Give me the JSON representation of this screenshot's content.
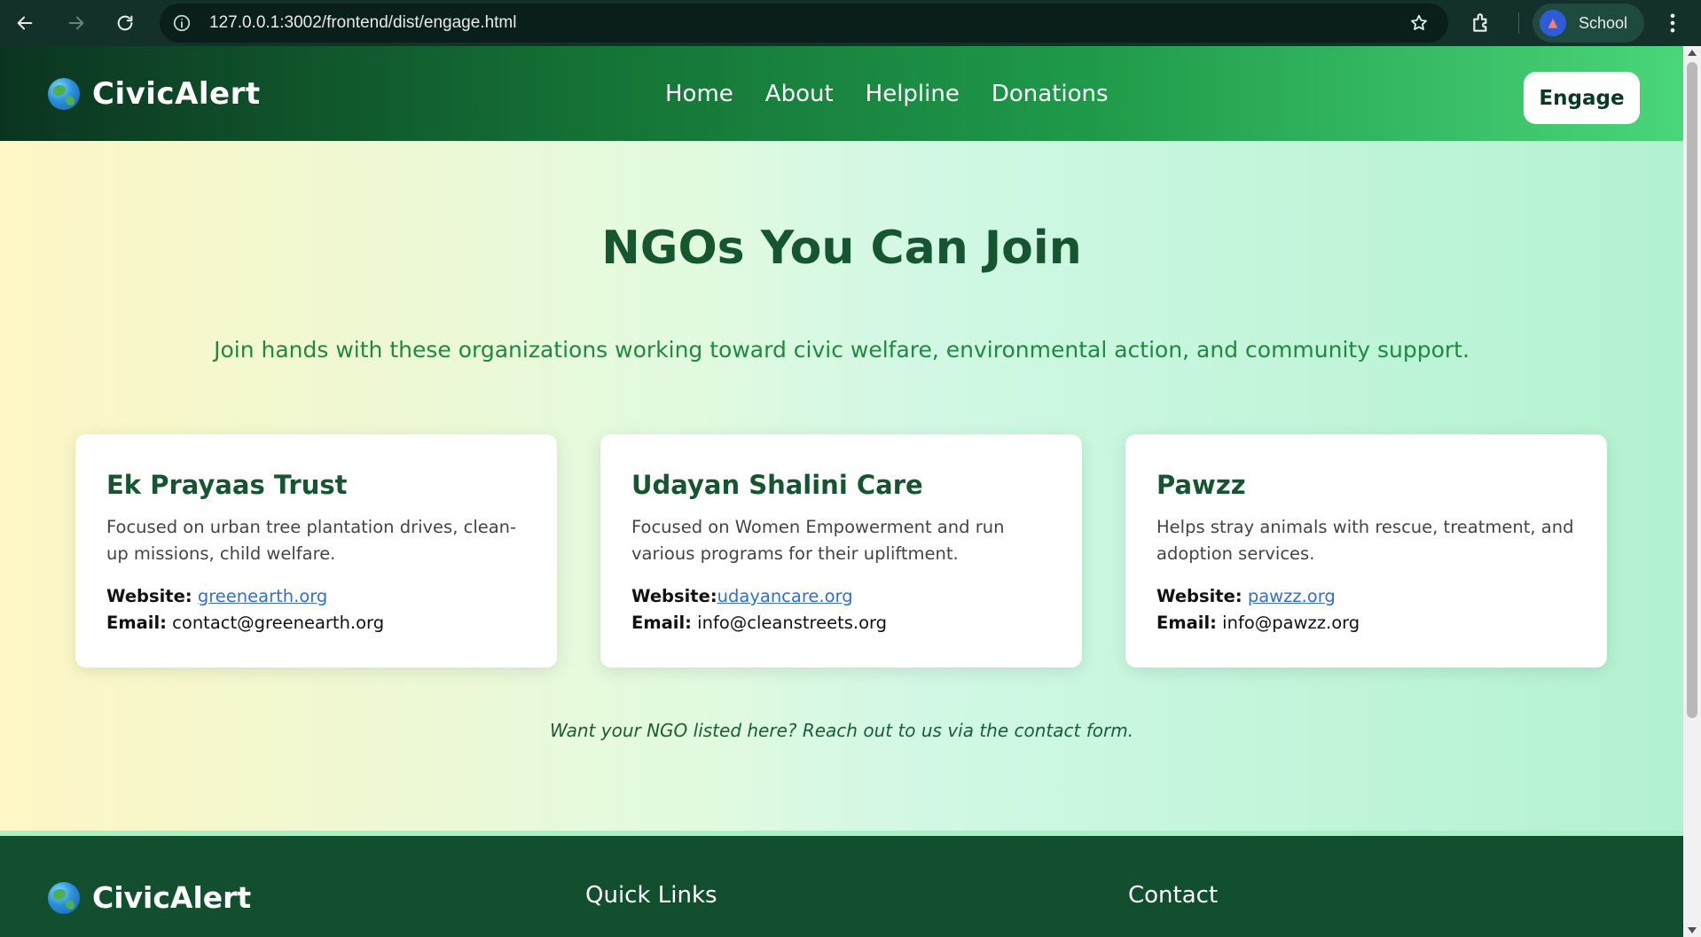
{
  "browser": {
    "url": "127.0.0.1:3002/frontend/dist/engage.html",
    "profile_label": "School"
  },
  "header": {
    "brand": "CivicAlert",
    "nav": [
      "Home",
      "About",
      "Helpline",
      "Donations"
    ],
    "engage_label": "Engage"
  },
  "hero": {
    "title": "NGOs You Can Join",
    "subtitle": "Join hands with these organizations working toward civic welfare, environmental action, and community support."
  },
  "ngos": [
    {
      "name": "Ek Prayaas Trust",
      "description": "Focused on urban tree plantation drives, clean-up missions, child welfare.",
      "website_label": "Website:",
      "website": "greenearth.org",
      "email_label": "Email:",
      "email": "contact@greenearth.org"
    },
    {
      "name": "Udayan Shalini Care",
      "description": "Focused on Women Empowerment and run various programs for their upliftment.",
      "website_label": "Website:",
      "website": "udayancare.org",
      "email_label": "Email:",
      "email": "info@cleanstreets.org"
    },
    {
      "name": "Pawzz",
      "description": "Helps stray animals with rescue, treatment, and adoption services.",
      "website_label": "Website:",
      "website": "pawzz.org",
      "email_label": "Email:",
      "email": "info@pawzz.org"
    }
  ],
  "note": "Want your NGO listed here? Reach out to us via the contact form.",
  "footer": {
    "brand": "CivicAlert",
    "quick_links_title": "Quick Links",
    "contact_title": "Contact"
  },
  "colors": {
    "brand_dark": "#155630",
    "accent_green": "#1d8a40",
    "link_blue": "#2f6fd0",
    "footer_bg": "#124f2e"
  },
  "icons": [
    "back-arrow-icon",
    "forward-arrow-icon",
    "reload-icon",
    "site-info-icon",
    "bookmark-star-icon",
    "extensions-icon",
    "menu-kebab-icon",
    "globe-icon"
  ]
}
